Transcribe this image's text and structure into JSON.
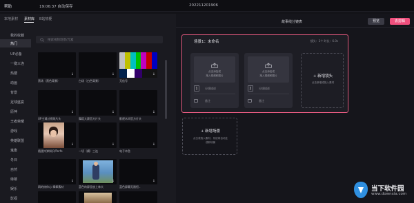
{
  "topbar": {
    "help": "帮助",
    "saved": "19:06:37 自动保存",
    "date": "202211201906"
  },
  "left": {
    "tabs": [
      "本地素材",
      "素材库",
      "B站热梗"
    ],
    "search_placeholder": "搜索视频场景/元素",
    "categories": [
      "我的收藏",
      "热门",
      "UP必备",
      "一键三连",
      "热梗",
      "动画",
      "背景",
      "足球盛宴",
      "原神",
      "王者荣耀",
      "游戏",
      "英雄联盟",
      "鬼畜",
      "冬日",
      "自然",
      "綠幕",
      "娱乐",
      "影视"
    ],
    "thumbnails": [
      {
        "label": "黑场（黑色背景）"
      },
      {
        "label": "白场（白色背景）"
      },
      {
        "label": "无信号"
      },
      {
        "label": "UP主通过视频片头"
      },
      {
        "label": "舞蹈大赛官方片头"
      },
      {
        "label": "影视木间官方片头"
      },
      {
        "label": "随便炸弹知识/Perfe"
      },
      {
        "label": "一切（横）三连"
      },
      {
        "label": "电子木鱼"
      },
      {
        "label": "网的修你心 棒棒素材"
      },
      {
        "label": "蓝色的屏显放上林大"
      },
      {
        "label": "蓝色屏幕无限恒.."
      }
    ]
  },
  "right": {
    "title": "故事线分镜表",
    "preview": "预览",
    "export": "去剪辑",
    "scene": {
      "name": "场景1：未命名",
      "stats": "镜头：2个  时长：6.0s",
      "shots": [
        {
          "num": "1",
          "upload1": "点击添加或",
          "upload2": "拖入视频和图片",
          "sub": "分镜描述",
          "note": "备注"
        },
        {
          "num": "2",
          "upload1": "点击添加或",
          "upload2": "拖入视频和图片",
          "sub": "分镜描述",
          "note": "备注"
        }
      ],
      "add_shot": "新增镜头",
      "add_shot_hint": "点击新增或拖入素材"
    },
    "add_scene": "新增场景",
    "add_scene_hint1": "点击或拖入素材，系统将自动生",
    "add_scene_hint2": "成新场景"
  },
  "watermark": {
    "title": "当下软件园",
    "url": "www.downxia.com"
  },
  "colors": {
    "accent": "#f0507e",
    "bg": "#131318",
    "panel": "#1a1a20"
  }
}
